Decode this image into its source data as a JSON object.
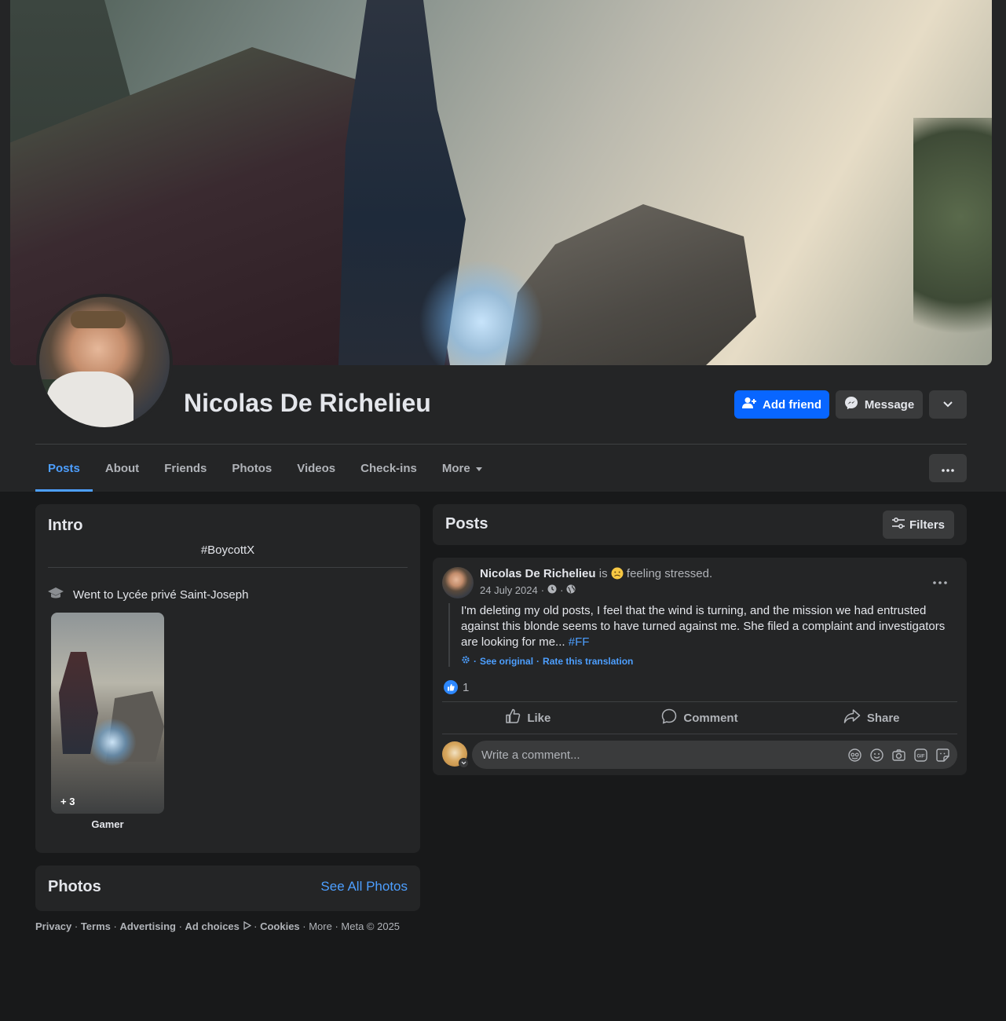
{
  "profile": {
    "name": "Nicolas De Richelieu",
    "add_friend_label": "Add friend",
    "message_label": "Message"
  },
  "tabs": [
    {
      "label": "Posts",
      "active": true
    },
    {
      "label": "About"
    },
    {
      "label": "Friends"
    },
    {
      "label": "Photos"
    },
    {
      "label": "Videos"
    },
    {
      "label": "Check-ins"
    },
    {
      "label": "More"
    }
  ],
  "intro": {
    "title": "Intro",
    "bio": "#BoycottX",
    "education": "Went to Lycée privé Saint-Joseph",
    "featured": {
      "count": "+ 3",
      "label": "Gamer"
    }
  },
  "photos_card": {
    "title": "Photos",
    "see_all": "See All Photos"
  },
  "footer": {
    "links": [
      "Privacy",
      "Terms",
      "Advertising",
      "Ad choices",
      "Cookies",
      "More"
    ],
    "copyright": "Meta © 2025"
  },
  "posts_header": {
    "title": "Posts",
    "filters_label": "Filters"
  },
  "post": {
    "author": "Nicolas De Richelieu",
    "is": "is",
    "feeling": "feeling stressed.",
    "date": "24 July 2024",
    "text": "I'm deleting my old posts, I feel that the wind is turning, and the mission we had entrusted against this blonde seems to have turned against me. She filed a complaint and investigators are looking for me...",
    "hashtag": "#FF",
    "see_original": "See original",
    "rate_translation": "Rate this translation",
    "like_count": "1",
    "actions": {
      "like": "Like",
      "comment": "Comment",
      "share": "Share"
    },
    "comment_placeholder": "Write a comment..."
  },
  "colors": {
    "accent": "#0866ff",
    "link": "#4d9fff",
    "background": "#18191a",
    "card": "#242526"
  }
}
